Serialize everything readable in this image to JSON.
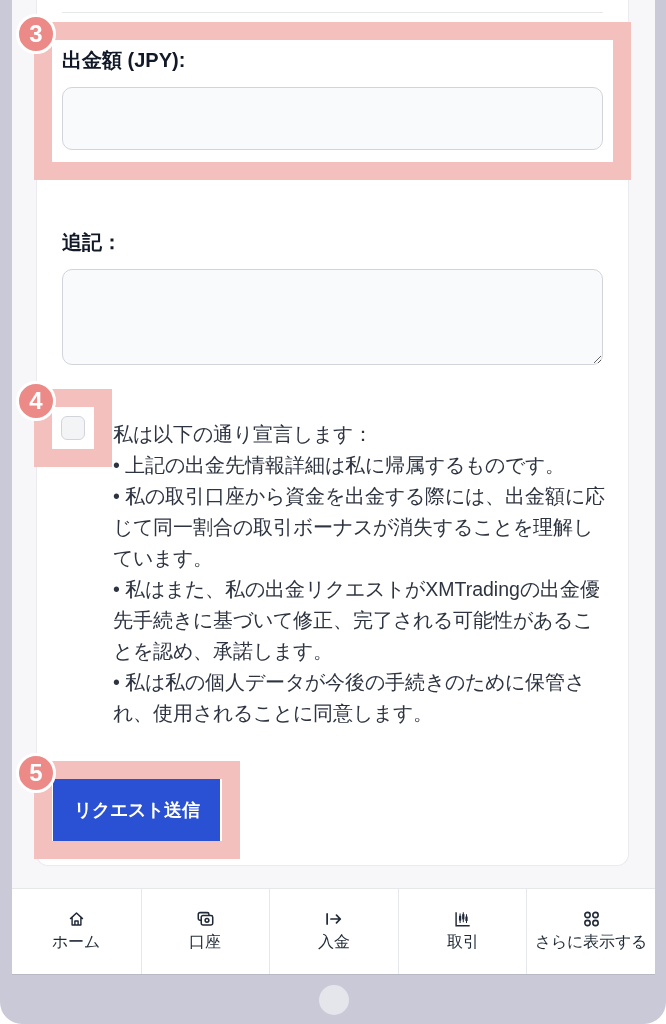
{
  "form": {
    "fields": [
      {
        "kind": "input",
        "label": "出金額 (JPY):",
        "callout": "3"
      },
      {
        "kind": "textarea",
        "label": "追記："
      }
    ],
    "declaration": {
      "checked": false,
      "callout": "4",
      "intro": "私は以下の通り宣言します：",
      "items": [
        "• 上記の出金先情報詳細は私に帰属するものです。",
        "• 私の取引口座から資金を出金する際には、出金額に応じて同一割合の取引ボーナスが消失することを理解しています。",
        "• 私はまた、私の出金リクエストがXMTradingの出金優先手続きに基づいて修正、完了される可能性があることを認め、承諾します。",
        "• 私は私の個人データが今後の手続きのために保管され、使用されることに同意します。"
      ]
    },
    "submit": {
      "label": "リクエスト送信",
      "callout": "5"
    }
  },
  "bottom_nav": [
    {
      "label": "ホーム",
      "selected": false
    },
    {
      "label": "口座",
      "selected": false
    },
    {
      "label": "入金",
      "selected": false
    },
    {
      "label": "取引",
      "selected": false
    },
    {
      "label": "さらに表示する",
      "selected": false
    }
  ]
}
